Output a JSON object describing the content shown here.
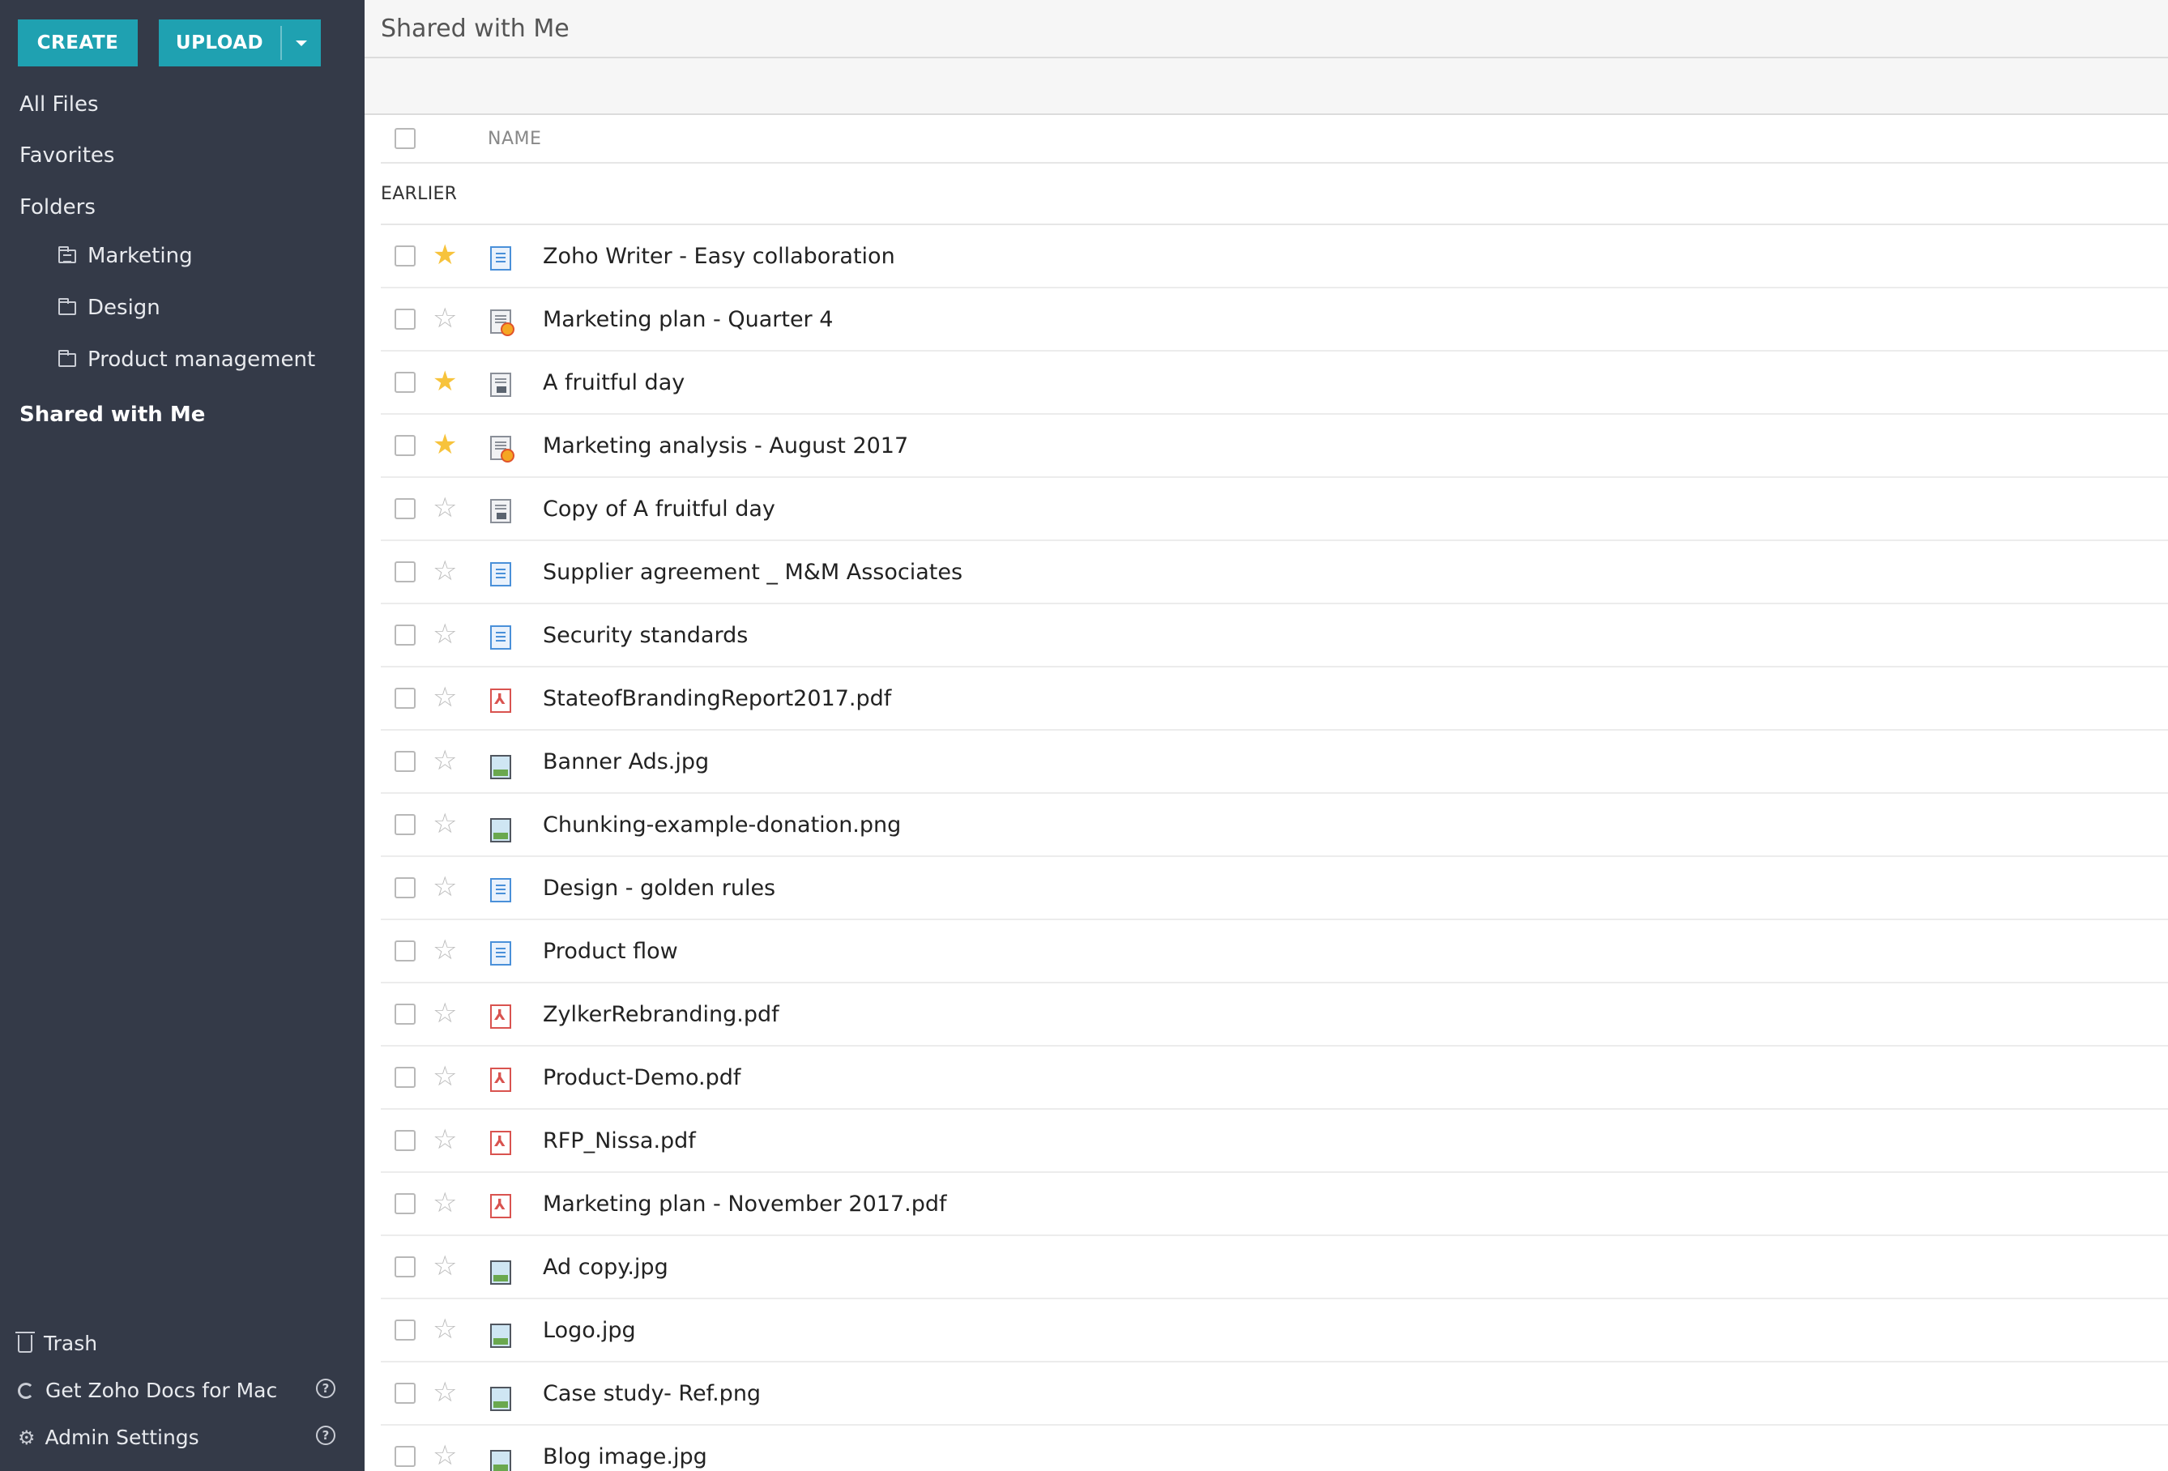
{
  "sidebar": {
    "create_label": "CREATE",
    "upload_label": "UPLOAD",
    "nav": {
      "all_files": "All Files",
      "favorites": "Favorites",
      "folders": "Folders",
      "folder_marketing": "Marketing",
      "folder_design": "Design",
      "folder_product_management": "Product management",
      "shared_with_me": "Shared with Me"
    },
    "bottom": {
      "trash": "Trash",
      "get_docs_mac": "Get Zoho Docs for Mac",
      "admin_settings": "Admin Settings"
    }
  },
  "main": {
    "title": "Shared with Me",
    "column_name": "NAME",
    "group_label": "EARLIER",
    "files": [
      {
        "name": "Zoho Writer - Easy collaboration",
        "type": "doc",
        "starred": true
      },
      {
        "name": "Marketing plan - Quarter 4",
        "type": "sheet",
        "starred": false
      },
      {
        "name": "A fruitful day",
        "type": "pres",
        "starred": true
      },
      {
        "name": "Marketing analysis - August 2017",
        "type": "sheet",
        "starred": true
      },
      {
        "name": "Copy of A fruitful day",
        "type": "pres",
        "starred": false
      },
      {
        "name": "Supplier agreement _ M&M Associates",
        "type": "doc",
        "starred": false
      },
      {
        "name": "Security standards",
        "type": "doc",
        "starred": false
      },
      {
        "name": "StateofBrandingReport2017.pdf",
        "type": "pdf",
        "starred": false
      },
      {
        "name": "Banner Ads.jpg",
        "type": "img",
        "starred": false
      },
      {
        "name": "Chunking-example-donation.png",
        "type": "img",
        "starred": false
      },
      {
        "name": "Design - golden rules",
        "type": "doc",
        "starred": false
      },
      {
        "name": "Product flow",
        "type": "doc",
        "starred": false
      },
      {
        "name": "ZylkerRebranding.pdf",
        "type": "pdf",
        "starred": false
      },
      {
        "name": "Product-Demo.pdf",
        "type": "pdf",
        "starred": false
      },
      {
        "name": "RFP_Nissa.pdf",
        "type": "pdf",
        "starred": false
      },
      {
        "name": "Marketing plan - November 2017.pdf",
        "type": "pdf",
        "starred": false
      },
      {
        "name": "Ad copy.jpg",
        "type": "img",
        "starred": false
      },
      {
        "name": "Logo.jpg",
        "type": "img",
        "starred": false
      },
      {
        "name": "Case study- Ref.png",
        "type": "img",
        "starred": false
      },
      {
        "name": "Blog image.jpg",
        "type": "img",
        "starred": false
      }
    ]
  }
}
